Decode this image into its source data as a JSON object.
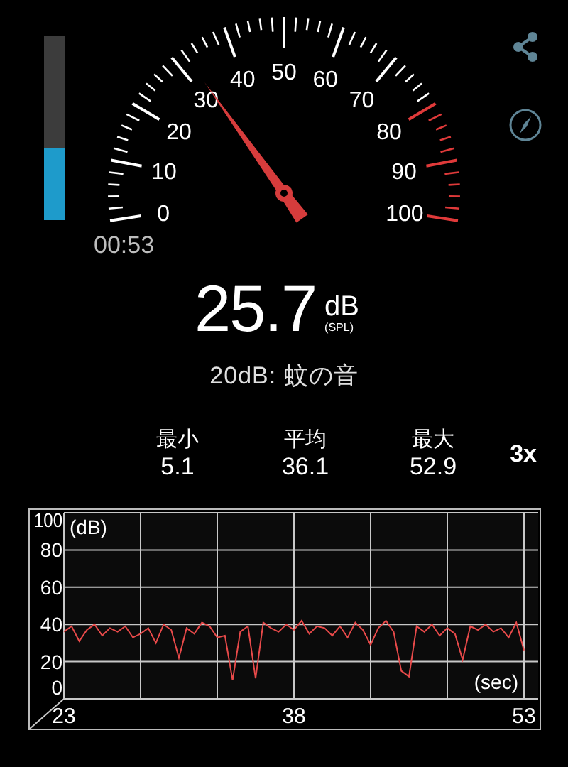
{
  "level_bar": {
    "level": 0.39
  },
  "gauge": {
    "left_labels": [
      "40",
      "30",
      "20",
      "10",
      "0"
    ],
    "right_labels": [
      "50",
      "60",
      "70",
      "80",
      "90",
      "100"
    ],
    "elapsed": "00:53"
  },
  "reading": {
    "value": "25.7",
    "unit": "dB",
    "unit_note": "(SPL)",
    "description": "20dB: 蚊の音"
  },
  "stats": [
    {
      "label": "最小",
      "value": "5.1"
    },
    {
      "label": "平均",
      "value": "36.1"
    },
    {
      "label": "最大",
      "value": "52.9"
    }
  ],
  "speed_button": "3x",
  "graph": {
    "chart_data": {
      "type": "line",
      "grid": true,
      "xlabel": "(sec)",
      "ylabel": "(dB)",
      "xlim": [
        23,
        53
      ],
      "ylim": [
        0,
        100
      ],
      "xticks": [
        23,
        38,
        53
      ],
      "yticks": [
        0,
        20,
        40,
        60,
        80,
        100
      ],
      "x": [
        23,
        23.5,
        24,
        24.5,
        25,
        25.5,
        26,
        26.5,
        27,
        27.5,
        28,
        28.5,
        29,
        29.5,
        30,
        30.5,
        31,
        31.5,
        32,
        32.5,
        33,
        33.5,
        34,
        34.5,
        35,
        35.5,
        36,
        36.5,
        37,
        37.5,
        38,
        38.5,
        39,
        39.5,
        40,
        40.5,
        41,
        41.5,
        42,
        42.5,
        43,
        43.5,
        44,
        44.5,
        45,
        45.5,
        46,
        46.5,
        47,
        47.5,
        48,
        48.5,
        49,
        49.5,
        50,
        50.5,
        51,
        51.5,
        52,
        52.5,
        53
      ],
      "series": [
        {
          "color": "#e84a4a",
          "values": [
            36,
            39,
            31,
            37,
            40,
            34,
            38,
            36,
            39,
            33,
            35,
            38,
            30,
            40,
            37,
            22,
            38,
            35,
            41,
            39,
            33,
            34,
            10,
            36,
            39,
            11,
            41,
            38,
            36,
            40,
            37,
            42,
            35,
            39,
            38,
            34,
            39,
            33,
            41,
            37,
            29,
            38,
            42,
            36,
            15,
            12,
            39,
            36,
            40,
            34,
            38,
            35,
            21,
            39,
            37,
            40,
            36,
            38,
            33,
            41,
            26
          ]
        }
      ]
    }
  }
}
